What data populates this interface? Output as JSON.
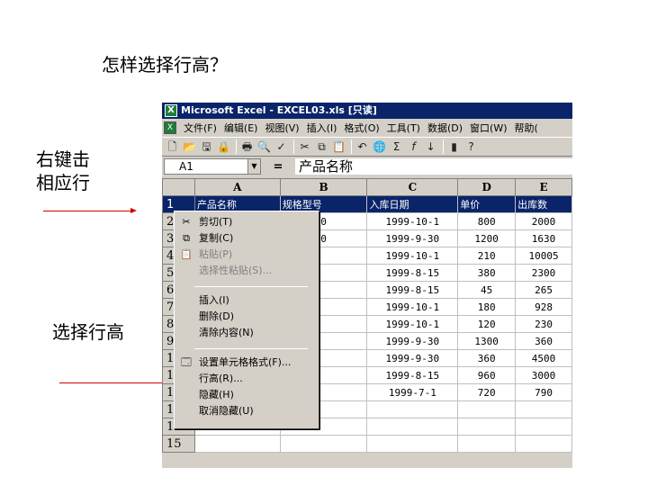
{
  "slide": {
    "title": "怎样选择行高？",
    "note_right_click_line1": "右键击",
    "note_right_click_line2": "相应行",
    "note_select_row_height": "选择行高"
  },
  "window": {
    "title": "Microsoft Excel - EXCEL03.xls [只读]",
    "app_icon": "X"
  },
  "menubar": {
    "items": [
      "文件(F)",
      "编辑(E)",
      "视图(V)",
      "插入(I)",
      "格式(O)",
      "工具(T)",
      "数据(D)",
      "窗口(W)",
      "帮助("
    ]
  },
  "toolbar": {
    "icons": [
      "new-file-icon",
      "open-folder-icon",
      "save-icon",
      "permission-icon",
      "print-icon",
      "print-preview-icon",
      "spelling-icon",
      "cut-icon",
      "copy-icon",
      "paste-icon",
      "undo-icon",
      "hyperlink-icon",
      "autosum-icon",
      "function-icon",
      "sort-ascending-icon",
      "chart-wizard-icon",
      "help-icon"
    ]
  },
  "formula_bar": {
    "name_box": "A1",
    "equals": "=",
    "content": "产品名称"
  },
  "grid": {
    "columns": [
      "A",
      "B",
      "C",
      "D",
      "E"
    ],
    "rows": [
      {
        "num": "1",
        "cells": [
          "产品名称",
          "规格型号",
          "入库日期",
          "单价",
          "出库数"
        ]
      },
      {
        "num": "2",
        "cells": [
          "",
          "0",
          "1999-10-1",
          "800",
          "2000"
        ]
      },
      {
        "num": "3",
        "cells": [
          "",
          "0",
          "1999-9-30",
          "1200",
          "1630"
        ]
      },
      {
        "num": "4",
        "cells": [
          "",
          "",
          "1999-10-1",
          "210",
          "10005"
        ]
      },
      {
        "num": "5",
        "cells": [
          "",
          "",
          "1999-8-15",
          "380",
          "2300"
        ]
      },
      {
        "num": "6",
        "cells": [
          "",
          "",
          "1999-8-15",
          "45",
          "265"
        ]
      },
      {
        "num": "7",
        "cells": [
          "",
          "",
          "1999-10-1",
          "180",
          "928"
        ]
      },
      {
        "num": "8",
        "cells": [
          "",
          "",
          "1999-10-1",
          "120",
          "230"
        ]
      },
      {
        "num": "9",
        "cells": [
          "",
          "",
          "1999-9-30",
          "1300",
          "360"
        ]
      },
      {
        "num": "1",
        "cells": [
          "",
          "",
          "1999-9-30",
          "360",
          "4500"
        ]
      },
      {
        "num": "1",
        "cells": [
          "",
          "",
          "1999-8-15",
          "960",
          "3000"
        ]
      },
      {
        "num": "1",
        "cells": [
          "",
          "",
          "1999-7-1",
          "720",
          "790"
        ]
      },
      {
        "num": "1",
        "cells": [
          "",
          "",
          "",
          "",
          ""
        ]
      },
      {
        "num": "14",
        "cells": [
          "",
          "",
          "",
          "",
          ""
        ]
      },
      {
        "num": "15",
        "cells": [
          "",
          "",
          "",
          "",
          ""
        ]
      }
    ]
  },
  "context_menu": {
    "cut": "剪切(T)",
    "copy": "复制(C)",
    "paste": "粘贴(P)",
    "paste_special": "选择性粘贴(S)...",
    "insert": "插入(I)",
    "delete": "删除(D)",
    "clear": "清除内容(N)",
    "format_cells": "设置单元格格式(F)...",
    "row_height": "行高(R)...",
    "hide": "隐藏(H)",
    "unhide": "取消隐藏(U)"
  },
  "colors": {
    "titlebar": "#0a246a",
    "selection": "#0a246a",
    "arrow": "#d00000",
    "chrome": "#d4d0c8"
  }
}
